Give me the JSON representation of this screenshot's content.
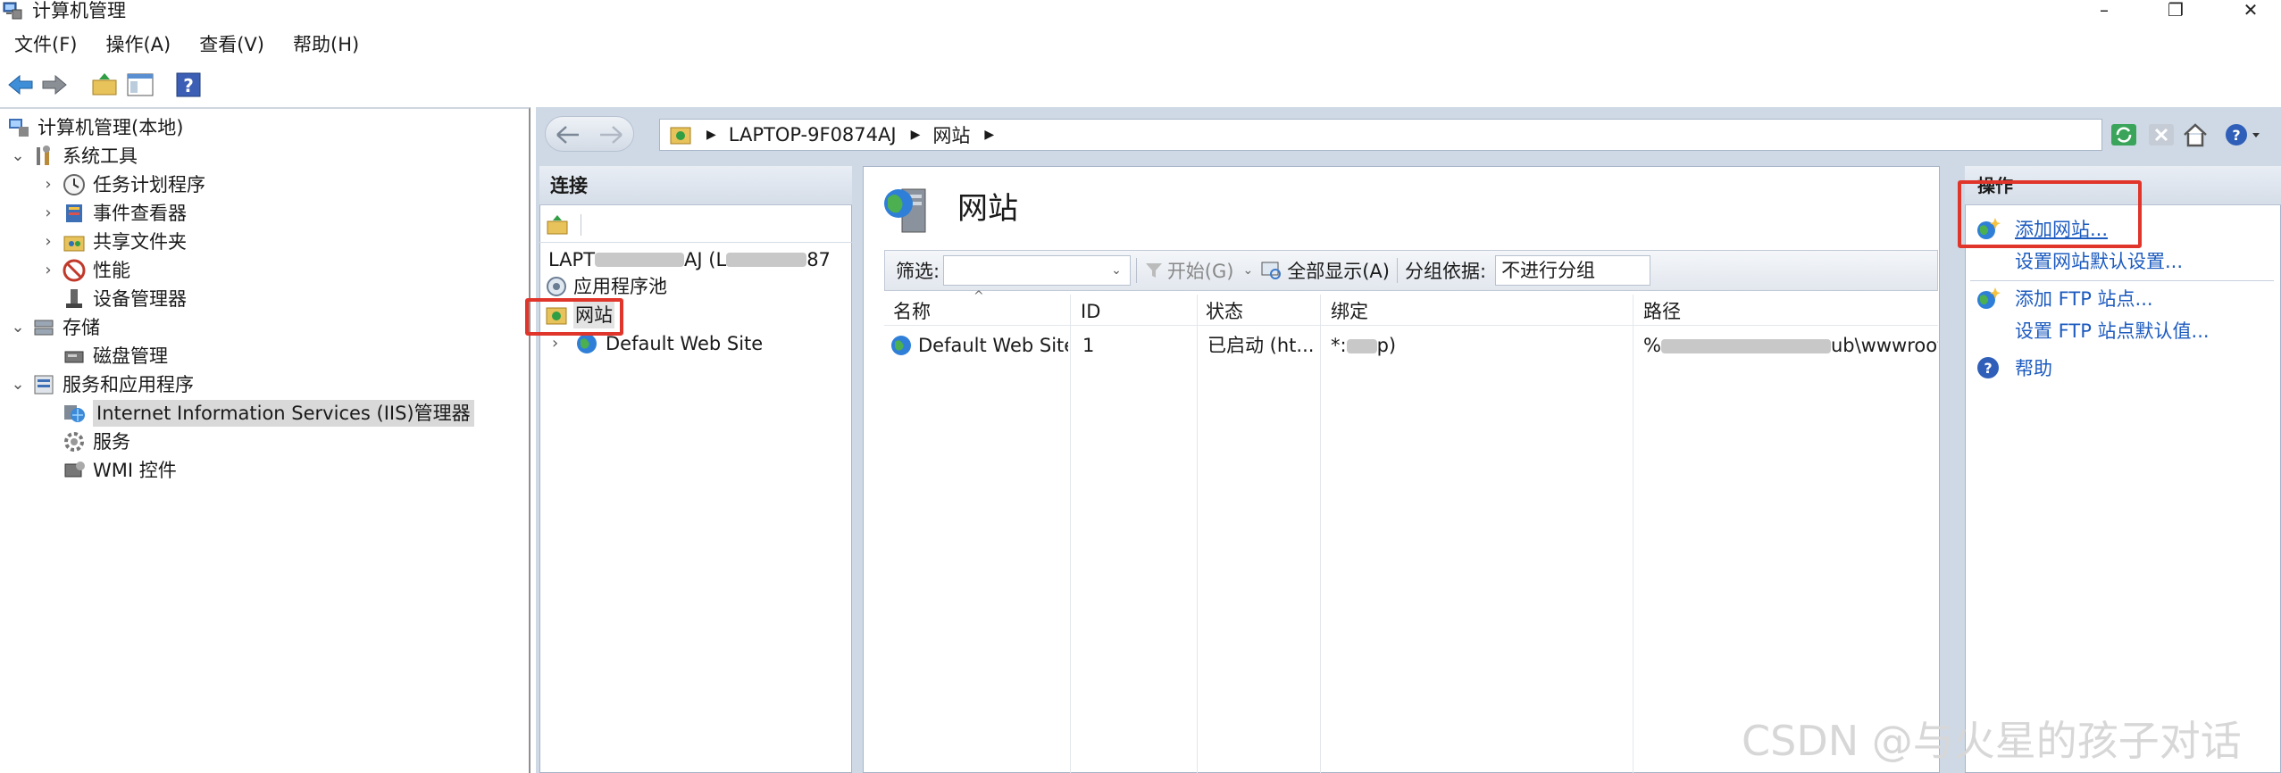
{
  "window": {
    "title": "计算机管理",
    "controls": [
      "–",
      "❐",
      "✕"
    ]
  },
  "menubar": {
    "items": [
      "文件(F)",
      "操作(A)",
      "查看(V)",
      "帮助(H)"
    ]
  },
  "tree": {
    "root": "计算机管理(本地)",
    "system_tools": "系统工具",
    "task_scheduler": "任务计划程序",
    "event_viewer": "事件查看器",
    "shared_folders": "共享文件夹",
    "performance": "性能",
    "device_manager": "设备管理器",
    "storage": "存储",
    "disk_management": "磁盘管理",
    "services_apps": "服务和应用程序",
    "iis_manager": "Internet Information Services (IIS)管理器",
    "services": "服务",
    "wmi": "WMI 控件"
  },
  "address": {
    "crumbs": [
      "LAPTOP-9F0874AJ",
      "网站"
    ]
  },
  "connections": {
    "header": "连接",
    "server_prefix": "LAPT",
    "server_mid": "AJ (L",
    "server_suffix": "87",
    "app_pools": "应用程序池",
    "sites": "网站",
    "default_site": "Default Web Site"
  },
  "content": {
    "title": "网站",
    "filter_label": "筛选:",
    "go_label": "开始(G)",
    "show_all_label": "全部显示(A)",
    "group_by_label": "分组依据:",
    "group_by_value": "不进行分组",
    "columns": [
      "名称",
      "ID",
      "状态",
      "绑定",
      "路径"
    ],
    "rows": [
      {
        "name": "Default Web Site",
        "id": "1",
        "status": "已启动 (ht...",
        "binding_prefix": "*:",
        "binding_suffix": "p)",
        "path_prefix": "%",
        "path_suffix": "ub\\wwwroot"
      }
    ]
  },
  "actions": {
    "header": "操作",
    "add_site": "添加网站...",
    "site_defaults": "设置网站默认设置...",
    "add_ftp": "添加 FTP 站点...",
    "ftp_defaults": "设置 FTP 站点默认值...",
    "help": "帮助"
  },
  "watermark": "CSDN @与火星的孩子对话",
  "colors": {
    "highlight_box": "#e0352b",
    "link": "#1d5bbf",
    "pane_bg": "#cfd9e6"
  }
}
